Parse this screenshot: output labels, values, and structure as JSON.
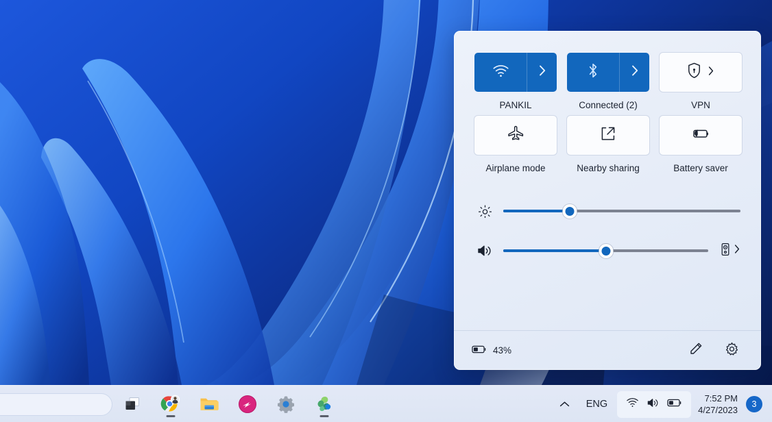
{
  "desktop": {
    "wallpaper_name": "windows-11-bloom-wallpaper",
    "colors": {
      "deep_blue": "#0b2c82",
      "mid_blue": "#1448c4",
      "bright_blue": "#2f7bf0",
      "light_blue": "#5aa0ff",
      "pale": "#dbe4f0"
    }
  },
  "taskbar": {
    "search": {
      "placeholder": ""
    },
    "apps": [
      {
        "name": "task-view",
        "label": "Task view",
        "active": false
      },
      {
        "name": "google-chrome",
        "label": "Google Chrome",
        "active": true
      },
      {
        "name": "file-explorer",
        "label": "File Explorer",
        "active": false
      },
      {
        "name": "pink-app",
        "label": "App",
        "active": false
      },
      {
        "name": "settings",
        "label": "Settings",
        "active": false
      },
      {
        "name": "microsoft-office",
        "label": "Microsoft 365",
        "active": true
      }
    ],
    "tray": {
      "overflow_label": "show-hidden-icons",
      "language": "ENG",
      "quick_settings_icons": [
        "wifi-icon",
        "volume-icon",
        "battery-icon"
      ],
      "time": "7:52 PM",
      "date": "4/27/2023",
      "notification_count": "3"
    }
  },
  "quick_settings": {
    "tiles": [
      {
        "name": "wifi",
        "icon": "wifi-icon",
        "label": "PANKIL",
        "state": "on",
        "split": true
      },
      {
        "name": "bluetooth",
        "icon": "bluetooth-icon",
        "label": "Connected (2)",
        "state": "on",
        "split": true
      },
      {
        "name": "vpn",
        "icon": "shield-lock-icon",
        "label": "VPN",
        "state": "off",
        "split": false
      },
      {
        "name": "airplane-mode",
        "icon": "airplane-icon",
        "label": "Airplane mode",
        "state": "off",
        "split": false
      },
      {
        "name": "nearby-sharing",
        "icon": "share-icon",
        "label": "Nearby sharing",
        "state": "off",
        "split": false
      },
      {
        "name": "battery-saver",
        "icon": "battery-saver-icon",
        "label": "Battery saver",
        "state": "off",
        "split": false
      }
    ],
    "sliders": [
      {
        "name": "brightness",
        "icon": "brightness-icon",
        "value": 28,
        "trailing": null
      },
      {
        "name": "volume",
        "icon": "volume-icon",
        "value": 50,
        "trailing": "audio-output-icon"
      }
    ],
    "footer": {
      "battery_percent": "43%",
      "edit_label": "edit-quick-settings",
      "settings_label": "open-settings"
    },
    "accent_color": "#1267bd",
    "panel_background": "#e9eff8"
  }
}
